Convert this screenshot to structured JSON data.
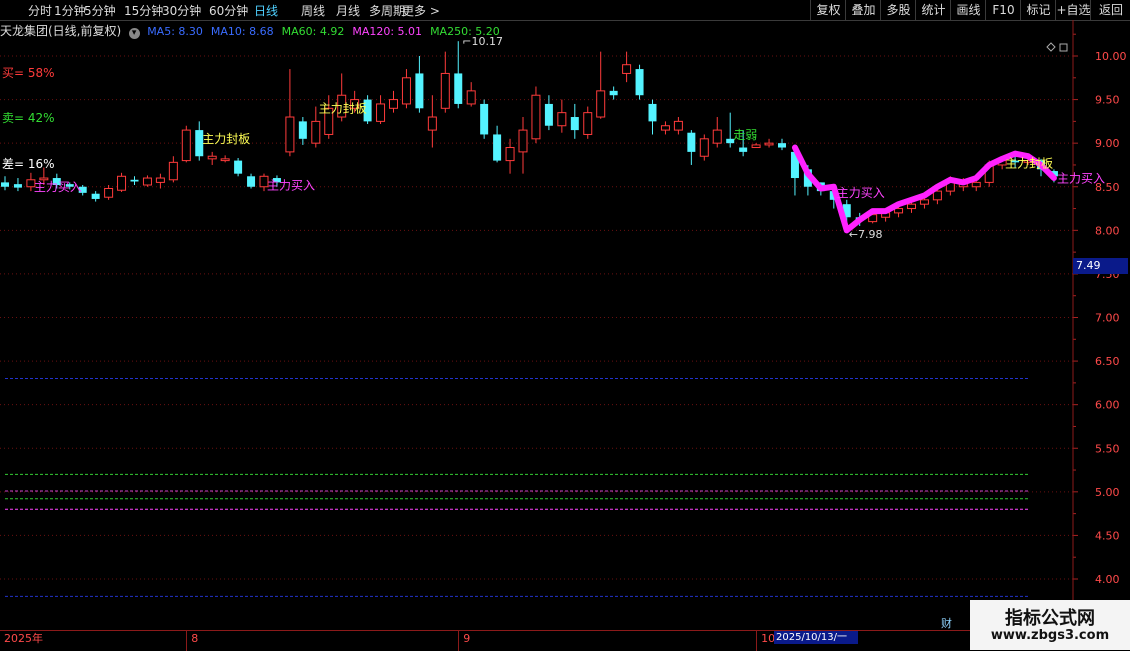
{
  "toolbar": {
    "periods": [
      "分时",
      "1分钟",
      "5分钟",
      "15分钟",
      "30分钟",
      "60分钟",
      "日线",
      "周线",
      "月线",
      "多周期",
      "更多 >"
    ],
    "active": "日线",
    "right": [
      "复权",
      "叠加",
      "多股",
      "统计",
      "画线",
      "F10",
      "标记",
      "+自选",
      "返回"
    ]
  },
  "info": {
    "title": "天龙集团(日线,前复权)",
    "ma": [
      {
        "label": "MA5: 8.30",
        "color": "#3a6cff"
      },
      {
        "label": "MA10: 8.68",
        "color": "#3a6cff"
      },
      {
        "label": "MA60: 4.92",
        "color": "#33dd33"
      },
      {
        "label": "MA120: 5.01",
        "color": "#ff44ff"
      },
      {
        "label": "MA250: 5.20",
        "color": "#33dd33"
      }
    ]
  },
  "left_stats": [
    {
      "label": "买= 58%",
      "color": "#ff3b3b"
    },
    {
      "label": "卖= 42%",
      "color": "#33dd33"
    },
    {
      "label": "差= 16%",
      "color": "#ffffff"
    }
  ],
  "chart_data": {
    "type": "candlestick",
    "yticks": [
      4.0,
      4.5,
      5.0,
      5.5,
      6.0,
      6.5,
      7.0,
      7.5,
      8.0,
      8.5,
      9.0,
      9.5,
      10.0
    ],
    "ylim": [
      3.7,
      10.35
    ],
    "high_label": "10.17",
    "low_label": "7.98",
    "current_price": "7.49",
    "candles": [
      [
        8.55,
        8.5,
        8.62,
        8.46
      ],
      [
        8.53,
        8.49,
        8.6,
        8.45
      ],
      [
        8.5,
        8.58,
        8.66,
        8.45
      ],
      [
        8.58,
        8.6,
        8.72,
        8.52
      ],
      [
        8.6,
        8.52,
        8.65,
        8.48
      ],
      [
        8.53,
        8.5,
        8.55,
        8.47
      ],
      [
        8.5,
        8.43,
        8.52,
        8.4
      ],
      [
        8.42,
        8.36,
        8.45,
        8.33
      ],
      [
        8.38,
        8.48,
        8.52,
        8.35
      ],
      [
        8.46,
        8.62,
        8.66,
        8.44
      ],
      [
        8.58,
        8.56,
        8.62,
        8.52
      ],
      [
        8.52,
        8.6,
        8.63,
        8.5
      ],
      [
        8.55,
        8.6,
        8.65,
        8.48
      ],
      [
        8.58,
        8.78,
        8.85,
        8.55
      ],
      [
        8.8,
        9.15,
        9.2,
        8.78
      ],
      [
        9.15,
        8.85,
        9.25,
        8.8
      ],
      [
        8.82,
        8.85,
        8.9,
        8.75
      ],
      [
        8.8,
        8.82,
        8.86,
        8.78
      ],
      [
        8.8,
        8.65,
        8.83,
        8.62
      ],
      [
        8.62,
        8.5,
        8.65,
        8.48
      ],
      [
        8.5,
        8.62,
        8.65,
        8.45
      ],
      [
        8.6,
        8.55,
        8.63,
        8.5
      ],
      [
        8.9,
        9.3,
        9.85,
        8.85
      ],
      [
        9.25,
        9.05,
        9.3,
        8.98
      ],
      [
        9.0,
        9.25,
        9.42,
        8.95
      ],
      [
        9.1,
        9.4,
        9.55,
        9.05
      ],
      [
        9.3,
        9.55,
        9.8,
        9.25
      ],
      [
        9.4,
        9.5,
        9.6,
        9.35
      ],
      [
        9.5,
        9.25,
        9.55,
        9.22
      ],
      [
        9.25,
        9.45,
        9.55,
        9.22
      ],
      [
        9.4,
        9.5,
        9.6,
        9.35
      ],
      [
        9.45,
        9.75,
        9.85,
        9.4
      ],
      [
        9.8,
        9.4,
        10.0,
        9.35
      ],
      [
        9.15,
        9.3,
        9.55,
        8.95
      ],
      [
        9.4,
        9.8,
        10.05,
        9.35
      ],
      [
        9.8,
        9.45,
        10.17,
        9.4
      ],
      [
        9.45,
        9.6,
        9.7,
        9.42
      ],
      [
        9.45,
        9.1,
        9.5,
        9.05
      ],
      [
        9.1,
        8.8,
        9.2,
        8.78
      ],
      [
        8.8,
        8.95,
        9.05,
        8.65
      ],
      [
        8.9,
        9.15,
        9.3,
        8.65
      ],
      [
        9.05,
        9.55,
        9.65,
        9.0
      ],
      [
        9.45,
        9.2,
        9.55,
        9.15
      ],
      [
        9.2,
        9.35,
        9.5,
        9.12
      ],
      [
        9.3,
        9.15,
        9.45,
        9.05
      ],
      [
        9.1,
        9.35,
        9.42,
        9.05
      ],
      [
        9.3,
        9.6,
        10.05,
        9.28
      ],
      [
        9.6,
        9.55,
        9.65,
        9.5
      ],
      [
        9.8,
        9.9,
        10.05,
        9.7
      ],
      [
        9.85,
        9.55,
        9.9,
        9.5
      ],
      [
        9.45,
        9.25,
        9.5,
        9.1
      ],
      [
        9.15,
        9.2,
        9.25,
        9.1
      ],
      [
        9.15,
        9.25,
        9.3,
        9.1
      ],
      [
        9.12,
        8.9,
        9.15,
        8.75
      ],
      [
        8.85,
        9.05,
        9.1,
        8.8
      ],
      [
        9.0,
        9.15,
        9.3,
        8.95
      ],
      [
        9.05,
        9.0,
        9.35,
        8.95
      ],
      [
        8.95,
        8.9,
        9.15,
        8.85
      ],
      [
        8.95,
        8.98,
        9.0,
        8.95
      ],
      [
        8.98,
        9.0,
        9.05,
        8.95
      ],
      [
        9.0,
        8.95,
        9.05,
        8.92
      ],
      [
        8.9,
        8.6,
        8.95,
        8.4
      ],
      [
        8.7,
        8.5,
        8.75,
        8.4
      ],
      [
        8.55,
        8.45,
        8.55,
        8.4
      ],
      [
        8.45,
        8.35,
        8.5,
        8.25
      ],
      [
        8.3,
        8.15,
        8.35,
        7.98
      ],
      [
        8.15,
        8.12,
        8.2,
        8.05
      ],
      [
        8.1,
        8.18,
        8.22,
        8.08
      ],
      [
        8.15,
        8.2,
        8.25,
        8.1
      ],
      [
        8.2,
        8.25,
        8.3,
        8.15
      ],
      [
        8.25,
        8.3,
        8.38,
        8.2
      ],
      [
        8.3,
        8.35,
        8.4,
        8.25
      ],
      [
        8.35,
        8.45,
        8.5,
        8.3
      ],
      [
        8.45,
        8.55,
        8.62,
        8.4
      ],
      [
        8.5,
        8.55,
        8.6,
        8.45
      ],
      [
        8.5,
        8.55,
        8.6,
        8.45
      ],
      [
        8.55,
        8.75,
        8.8,
        8.5
      ],
      [
        8.75,
        8.8,
        8.85,
        8.7
      ],
      [
        8.8,
        8.78,
        8.85,
        8.72
      ],
      [
        8.78,
        8.8,
        8.88,
        8.75
      ],
      [
        8.8,
        8.7,
        8.82,
        8.62
      ],
      [
        8.68,
        8.62,
        8.7,
        8.55
      ]
    ],
    "purple_line": [
      [
        61,
        8.95
      ],
      [
        62,
        8.65
      ],
      [
        63,
        8.48
      ],
      [
        64,
        8.5
      ],
      [
        65,
        8.0
      ],
      [
        66,
        8.12
      ],
      [
        67,
        8.22
      ],
      [
        68,
        8.22
      ],
      [
        69,
        8.3
      ],
      [
        70,
        8.35
      ],
      [
        71,
        8.4
      ],
      [
        72,
        8.5
      ],
      [
        73,
        8.58
      ],
      [
        74,
        8.55
      ],
      [
        75,
        8.6
      ],
      [
        76,
        8.75
      ],
      [
        77,
        8.82
      ],
      [
        78,
        8.88
      ],
      [
        79,
        8.85
      ],
      [
        80,
        8.75
      ],
      [
        81,
        8.6
      ]
    ],
    "hlines": [
      {
        "y": 6.3,
        "color": "#2233cc"
      },
      {
        "y": 5.2,
        "color": "#33cc33"
      },
      {
        "y": 5.01,
        "color": "#cc44cc"
      },
      {
        "y": 4.92,
        "color": "#33cc33"
      },
      {
        "y": 4.8,
        "color": "#ff44ff"
      },
      {
        "y": 3.8,
        "color": "#2233cc"
      }
    ],
    "annotations": [
      {
        "text": "主力买入",
        "idx": 2,
        "y": 8.45,
        "color": "#ff44ff"
      },
      {
        "text": "主力封板",
        "idx": 15,
        "y": 9.0,
        "color": "#ffff55"
      },
      {
        "text": "主力买入",
        "idx": 20,
        "y": 8.47,
        "color": "#ff44ff"
      },
      {
        "text": "主力封板",
        "idx": 24,
        "y": 9.35,
        "color": "#ffff55"
      },
      {
        "text": "走弱",
        "idx": 56,
        "y": 9.05,
        "color": "#33dd33"
      },
      {
        "text": "主力买入",
        "idx": 64,
        "y": 8.38,
        "color": "#ff44ff"
      },
      {
        "text": "主力封板",
        "idx": 77,
        "y": 8.72,
        "color": "#ffff55"
      },
      {
        "text": "主力买入",
        "idx": 81,
        "y": 8.55,
        "color": "#ff44ff"
      }
    ],
    "dates": [
      {
        "text": "2025年",
        "idx": 0
      },
      {
        "text": "8",
        "idx": 14
      },
      {
        "text": "9",
        "idx": 35
      },
      {
        "text": "10",
        "idx": 58
      }
    ],
    "cursor_date": "2025/10/13/一"
  },
  "watermark": {
    "line1": "指标公式网",
    "line2": "www.zbgs3.com"
  },
  "cai_label": "财"
}
